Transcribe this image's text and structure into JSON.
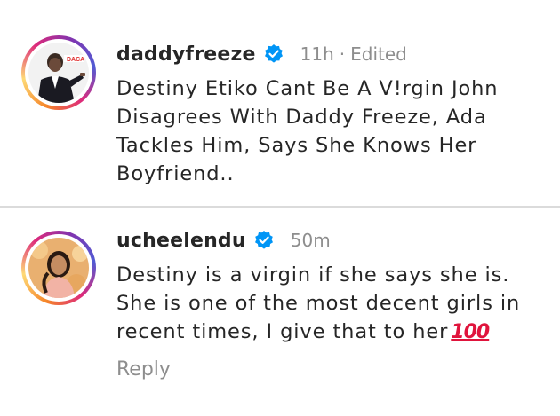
{
  "caption": {
    "username": "daddyfreeze",
    "time": "11h",
    "separator": "·",
    "edited": "Edited",
    "text": "Destiny Etiko Cant Be A V!rgin John Disagrees With Daddy Freeze, Ada Tackles Him, Says She Knows Her Boyfriend..",
    "avatar_icon": "profile-photo-man-in-suit",
    "avatar_logo_text": "DACA"
  },
  "comment": {
    "username": "ucheelendu",
    "time": "50m",
    "text": "Destiny is a virgin if she says she is. She is one of the most decent girls in recent times, I give that to her",
    "emoji": "100",
    "reply_label": "Reply",
    "avatar_icon": "profile-photo-woman"
  },
  "colors": {
    "text": "#262626",
    "secondary": "#8e8e8e",
    "verified": "#0095f6",
    "divider": "#dbdbdb",
    "emoji_red": "#e0143c"
  }
}
